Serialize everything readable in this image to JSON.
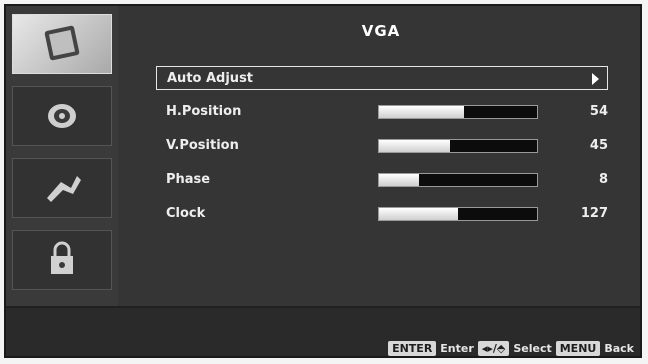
{
  "menu": {
    "title": "VGA",
    "items": [
      {
        "label": "Auto Adjust"
      },
      {
        "label": "H.Position",
        "value": "54",
        "level": 0.54
      },
      {
        "label": "V.Position",
        "value": "45",
        "level": 0.45
      },
      {
        "label": "Phase",
        "value": "8",
        "level": 0.25
      },
      {
        "label": "Clock",
        "value": "127",
        "level": 0.5
      }
    ]
  },
  "sidebar": {
    "items": [
      {
        "icon": "picture-icon",
        "active": true
      },
      {
        "icon": "audio-icon",
        "active": false
      },
      {
        "icon": "setup-icon",
        "active": false
      },
      {
        "icon": "lock-icon",
        "active": false
      }
    ]
  },
  "footer": {
    "enter_key": "ENTER",
    "enter_label": "Enter",
    "nav_key": "◂▸/⬘",
    "select_label": "Select",
    "menu_key": "MENU",
    "back_label": "Back"
  },
  "colors": {
    "background": "#353535",
    "bar_fill": "#ffffff",
    "bar_track": "#0c0c0c"
  }
}
